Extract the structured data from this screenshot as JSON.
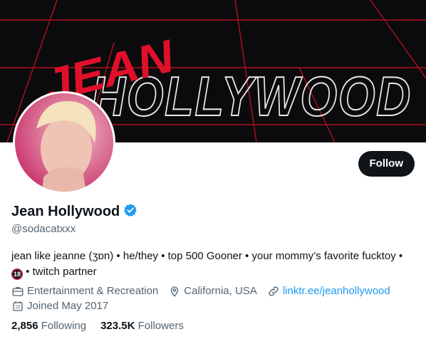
{
  "banner": {
    "title_script": "JEAN",
    "title_main": "HOLLYWOOD"
  },
  "profile": {
    "display_name": "Jean Hollywood",
    "handle": "@sodacatxxx",
    "verified": true,
    "bio_line1": "jean like jeanne (ʒɒn) • he/they • top 500 Gooner • your mommy’s favorite fucktoy •",
    "bio_badge": "18",
    "bio_line2": "• twitch partner",
    "category": "Entertainment & Recreation",
    "location": "California, USA",
    "link": "linktr.ee/jeanhollywood",
    "joined": "Joined May 2017"
  },
  "actions": {
    "follow_label": "Follow"
  },
  "stats": {
    "following_count": "2,856",
    "following_label": "Following",
    "followers_count": "323.5K",
    "followers_label": "Followers"
  },
  "colors": {
    "accent": "#1d9bf0",
    "banner_bg": "#0b0b0d",
    "neon_red": "#e0102a"
  }
}
